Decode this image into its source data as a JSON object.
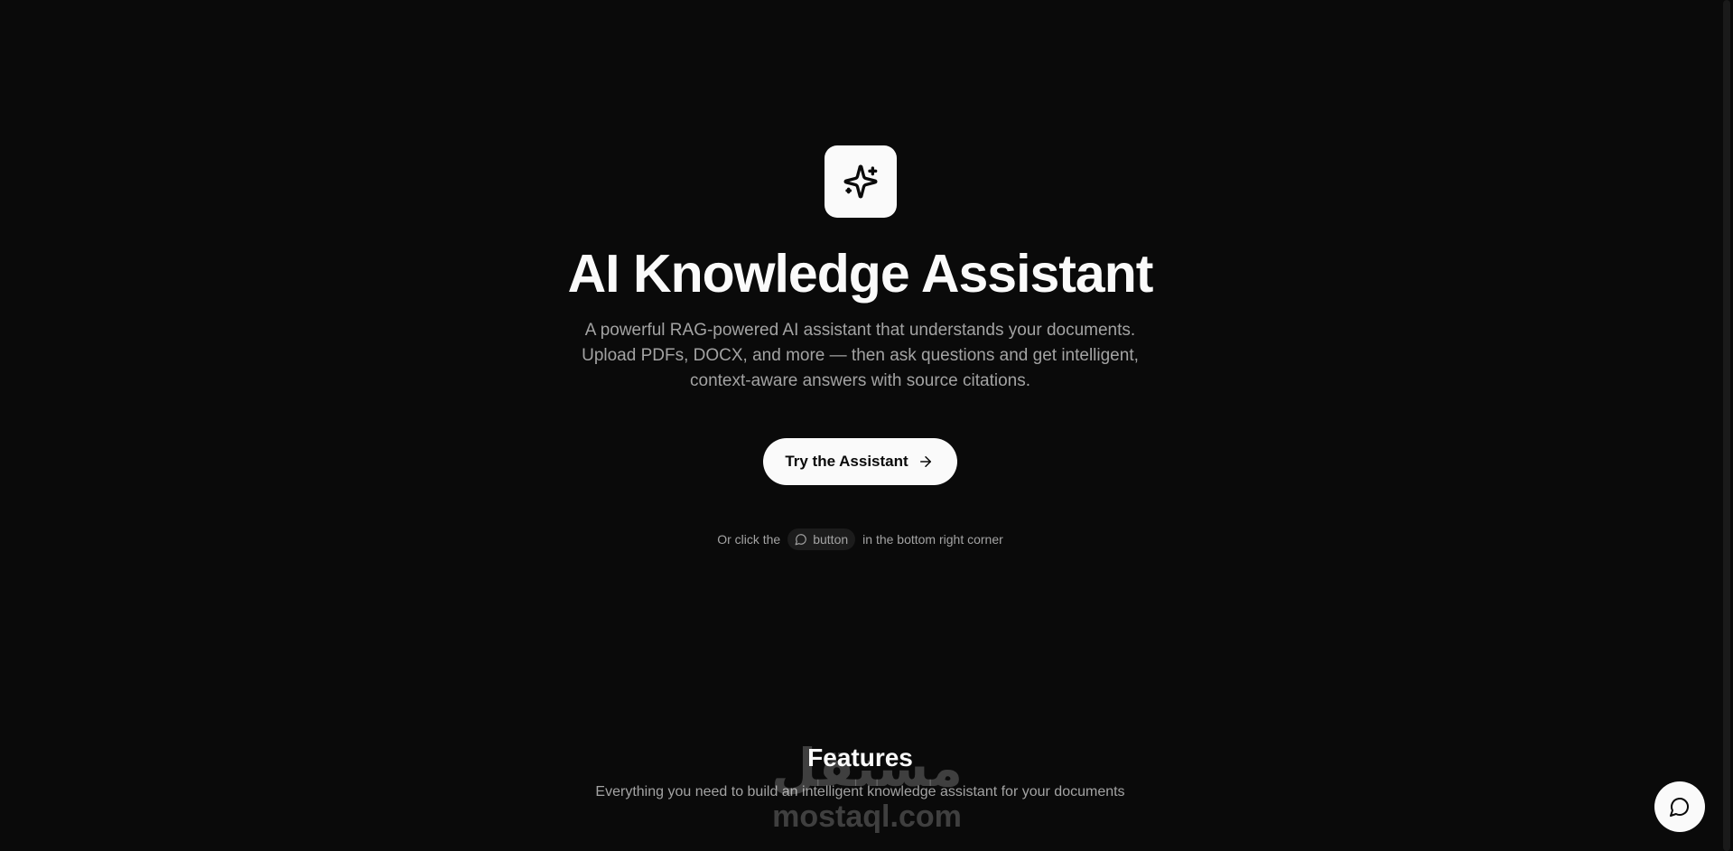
{
  "hero": {
    "title": "AI Knowledge Assistant",
    "subtitle": "A powerful RAG-powered AI assistant that understands your documents. Upload PDFs, DOCX, and more — then ask questions and get intelligent, context-aware answers with source citations.",
    "cta_label": "Try the Assistant",
    "hint_prefix": "Or click the",
    "hint_chip_label": "button",
    "hint_suffix": "in the bottom right corner"
  },
  "features": {
    "title": "Features",
    "subtitle": "Everything you need to build an intelligent knowledge assistant for your documents"
  },
  "watermark": {
    "arabic": "مستقل",
    "latin": "mostaql.com"
  },
  "icons": {
    "logo": "sparkles-icon",
    "cta": "arrow-right-icon",
    "hint": "message-circle-icon",
    "fab": "message-circle-icon"
  },
  "colors": {
    "background": "#0a0a0a",
    "foreground": "#fafafa",
    "muted": "#a3a3a3",
    "chip": "#1c1c1c"
  }
}
